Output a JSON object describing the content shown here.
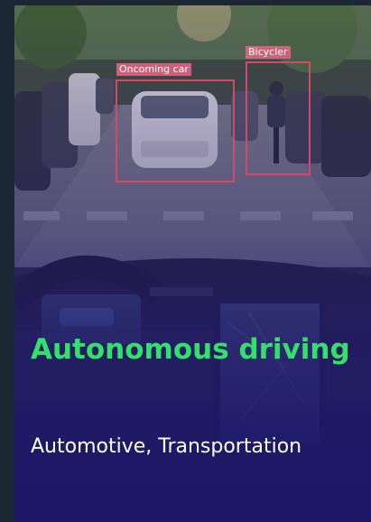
{
  "card": {
    "title": "Autonomous driving",
    "subtitle": "Automotive, Transportation"
  },
  "detections": [
    {
      "label": "Oncoming car"
    },
    {
      "label": "Bicycler"
    }
  ],
  "colors": {
    "page_background": "#1b2733",
    "title": "#33e06a",
    "subtitle": "#ffffff",
    "overlay": "#2a2070",
    "bbox": "#d04a6a"
  }
}
